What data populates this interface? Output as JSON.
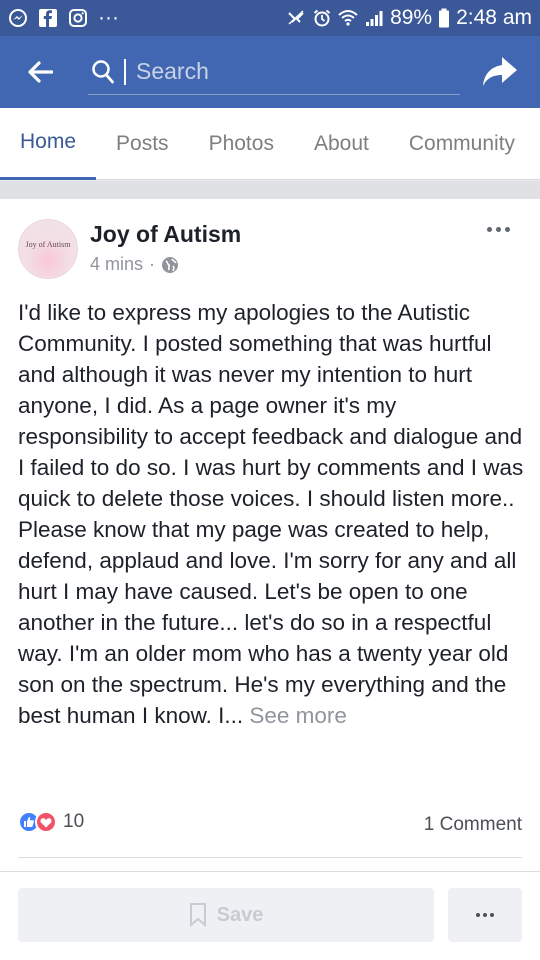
{
  "status_bar": {
    "battery": "89%",
    "time": "2:48 am",
    "left_icons": [
      "messenger-icon",
      "facebook-icon",
      "instagram-icon",
      "overflow-dots-icon"
    ],
    "right_icons": [
      "nfc-icon",
      "alarm-icon",
      "wifi-icon",
      "signal-icon",
      "battery-icon"
    ]
  },
  "top_bar": {
    "search_placeholder": "Search",
    "colors": {
      "header_bg": "#4267b2",
      "status_bg": "#3b5998"
    }
  },
  "tabs": [
    {
      "label": "Home",
      "active": true
    },
    {
      "label": "Posts",
      "active": false
    },
    {
      "label": "Photos",
      "active": false
    },
    {
      "label": "About",
      "active": false
    },
    {
      "label": "Community",
      "active": false
    }
  ],
  "post": {
    "page_name": "Joy of Autism",
    "avatar_text": "Joy of Autism",
    "time": "4 mins",
    "visibility_icon": "globe-icon",
    "paragraph1": "I'd like to express my apologies to the Autistic Community. I posted something that was hurtful and although it was never my intention to hurt anyone, I did. As a page owner it's my responsibility to accept feedback and dialogue and I failed to do so. I was hurt by comments and I was quick to delete those voices. I should listen more..",
    "paragraph2": "Please know that my page was created to help, defend, applaud and love. I'm sorry for any and all hurt I may have caused. Let's be open to one another in the future... let's do so in a respectful way. I'm an older mom who has a twenty year old son on the spectrum. He's my everything and the best human I know. I...",
    "see_more": "See more",
    "reaction_count": "10",
    "comment_count": "1 Comment"
  },
  "actions": {
    "save_label": "Save"
  }
}
